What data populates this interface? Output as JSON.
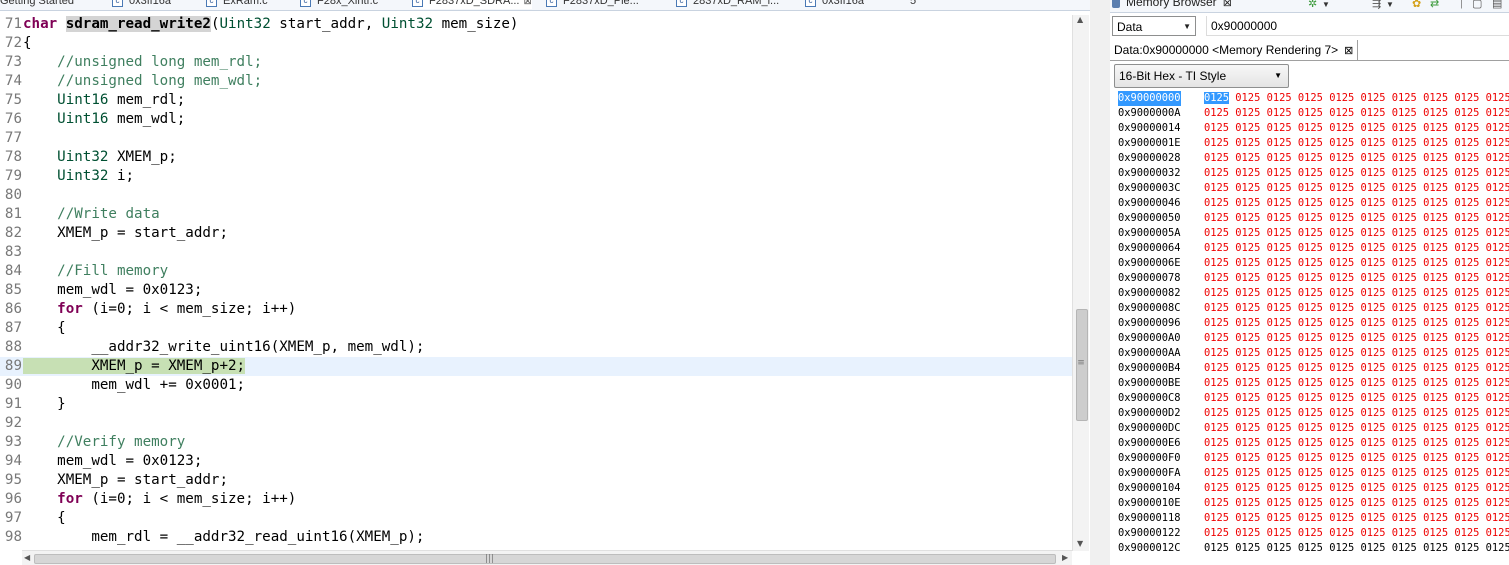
{
  "editor": {
    "tabs": [
      {
        "label": "Getting Started",
        "icon": "none",
        "close": false
      },
      {
        "label": "0x3ff16a",
        "icon": "c-file-icon",
        "close": false
      },
      {
        "label": "ExRam.c",
        "icon": "c-file-icon",
        "close": false
      },
      {
        "label": "F28x_Xintf.c",
        "icon": "c-file-icon",
        "close": false
      },
      {
        "label": "F2837xD_SDRA...",
        "icon": "c-file-icon",
        "close": true,
        "close_label": "⊠"
      },
      {
        "label": "F2837xD_Pie...",
        "icon": "c-file-icon",
        "close": false
      },
      {
        "label": "2837xD_RAM_l...",
        "icon": "linker-file-icon",
        "close": false
      },
      {
        "label": "0x3ff16a",
        "icon": "c-file-icon",
        "close": false
      },
      {
        "label": "5",
        "icon": "none",
        "close": false
      }
    ],
    "code_lines": [
      {
        "num": "71",
        "segments": [
          {
            "t": "kw",
            "s": "char"
          },
          {
            "t": "p",
            "s": " "
          },
          {
            "t": "fnd",
            "s": "sdram_read_write2"
          },
          {
            "t": "p",
            "s": "("
          },
          {
            "t": "ty",
            "s": "Uint32"
          },
          {
            "t": "p",
            "s": " start_addr, "
          },
          {
            "t": "ty",
            "s": "Uint32"
          },
          {
            "t": "p",
            "s": " mem_size)"
          }
        ]
      },
      {
        "num": "72",
        "segments": [
          {
            "t": "p",
            "s": "{"
          }
        ]
      },
      {
        "num": "73",
        "segments": [
          {
            "t": "cm",
            "s": "    //unsigned long mem_rdl;"
          }
        ]
      },
      {
        "num": "74",
        "segments": [
          {
            "t": "cm",
            "s": "    //unsigned long mem_wdl;"
          }
        ]
      },
      {
        "num": "75",
        "segments": [
          {
            "t": "ty",
            "s": "    Uint16"
          },
          {
            "t": "p",
            "s": " mem_rdl;"
          }
        ]
      },
      {
        "num": "76",
        "segments": [
          {
            "t": "ty",
            "s": "    Uint16"
          },
          {
            "t": "p",
            "s": " mem_wdl;"
          }
        ]
      },
      {
        "num": "77",
        "segments": []
      },
      {
        "num": "78",
        "segments": [
          {
            "t": "ty",
            "s": "    Uint32"
          },
          {
            "t": "p",
            "s": " XMEM_p;"
          }
        ]
      },
      {
        "num": "79",
        "segments": [
          {
            "t": "ty",
            "s": "    Uint32"
          },
          {
            "t": "p",
            "s": " i;"
          }
        ]
      },
      {
        "num": "80",
        "segments": []
      },
      {
        "num": "81",
        "segments": [
          {
            "t": "cm",
            "s": "    //Write data"
          }
        ]
      },
      {
        "num": "82",
        "segments": [
          {
            "t": "p",
            "s": "    XMEM_p = start_addr;"
          }
        ]
      },
      {
        "num": "83",
        "segments": []
      },
      {
        "num": "84",
        "segments": [
          {
            "t": "cm",
            "s": "    //Fill memory"
          }
        ]
      },
      {
        "num": "85",
        "segments": [
          {
            "t": "p",
            "s": "    mem_wdl = 0x0123;"
          }
        ]
      },
      {
        "num": "86",
        "segments": [
          {
            "t": "p",
            "s": "    "
          },
          {
            "t": "kw",
            "s": "for"
          },
          {
            "t": "p",
            "s": " (i=0; i < mem_size; i++)"
          }
        ]
      },
      {
        "num": "87",
        "segments": [
          {
            "t": "p",
            "s": "    {"
          }
        ]
      },
      {
        "num": "88",
        "segments": [
          {
            "t": "p",
            "s": "        __addr32_write_uint16(XMEM_p, mem_wdl);"
          }
        ]
      },
      {
        "num": "89",
        "current": true,
        "segments": [
          {
            "t": "hl",
            "s": "        XMEM_p = XMEM_p+2;"
          }
        ]
      },
      {
        "num": "90",
        "segments": [
          {
            "t": "p",
            "s": "        mem_wdl += 0x0001;"
          }
        ]
      },
      {
        "num": "91",
        "segments": [
          {
            "t": "p",
            "s": "    }"
          }
        ]
      },
      {
        "num": "92",
        "segments": []
      },
      {
        "num": "93",
        "segments": [
          {
            "t": "cm",
            "s": "    //Verify memory"
          }
        ]
      },
      {
        "num": "94",
        "segments": [
          {
            "t": "p",
            "s": "    mem_wdl = 0x0123;"
          }
        ]
      },
      {
        "num": "95",
        "segments": [
          {
            "t": "p",
            "s": "    XMEM_p = start_addr;"
          }
        ]
      },
      {
        "num": "96",
        "segments": [
          {
            "t": "p",
            "s": "    "
          },
          {
            "t": "kw",
            "s": "for"
          },
          {
            "t": "p",
            "s": " (i=0; i < mem_size; i++)"
          }
        ]
      },
      {
        "num": "97",
        "segments": [
          {
            "t": "p",
            "s": "    {"
          }
        ]
      },
      {
        "num": "98",
        "segments": [
          {
            "t": "p",
            "s": "        mem_rdl = __addr32_read_uint16(XMEM_p);"
          }
        ]
      }
    ],
    "vscroll_grip": "≡",
    "hscroll_grip": "|||"
  },
  "memory": {
    "view_title": "Memory Browser",
    "view_close": "⊠",
    "space_value": "Data",
    "address_value": "0x90000000",
    "rendering_tab": "Data:0x90000000 <Memory Rendering 7>",
    "rendering_close": "⊠",
    "format_value": "16-Bit Hex - TI Style",
    "cell_value": "0125",
    "cells_per_row": 10,
    "rows": [
      {
        "addr": "0x90000000",
        "changed": true,
        "selected": true
      },
      {
        "addr": "0x9000000A",
        "changed": true
      },
      {
        "addr": "0x90000014",
        "changed": true
      },
      {
        "addr": "0x9000001E",
        "changed": true
      },
      {
        "addr": "0x90000028",
        "changed": true
      },
      {
        "addr": "0x90000032",
        "changed": true
      },
      {
        "addr": "0x9000003C",
        "changed": true
      },
      {
        "addr": "0x90000046",
        "changed": true
      },
      {
        "addr": "0x90000050",
        "changed": true
      },
      {
        "addr": "0x9000005A",
        "changed": true
      },
      {
        "addr": "0x90000064",
        "changed": true
      },
      {
        "addr": "0x9000006E",
        "changed": true
      },
      {
        "addr": "0x90000078",
        "changed": true
      },
      {
        "addr": "0x90000082",
        "changed": true
      },
      {
        "addr": "0x9000008C",
        "changed": true
      },
      {
        "addr": "0x90000096",
        "changed": true
      },
      {
        "addr": "0x900000A0",
        "changed": true
      },
      {
        "addr": "0x900000AA",
        "changed": true
      },
      {
        "addr": "0x900000B4",
        "changed": true
      },
      {
        "addr": "0x900000BE",
        "changed": true
      },
      {
        "addr": "0x900000C8",
        "changed": true
      },
      {
        "addr": "0x900000D2",
        "changed": true
      },
      {
        "addr": "0x900000DC",
        "changed": true
      },
      {
        "addr": "0x900000E6",
        "changed": true
      },
      {
        "addr": "0x900000F0",
        "changed": true
      },
      {
        "addr": "0x900000FA",
        "changed": true
      },
      {
        "addr": "0x90000104",
        "changed": true
      },
      {
        "addr": "0x9000010E",
        "changed": true
      },
      {
        "addr": "0x90000118",
        "changed": true
      },
      {
        "addr": "0x90000122",
        "changed": true
      },
      {
        "addr": "0x9000012C",
        "changed": false
      }
    ]
  },
  "colors": {
    "changed_value": "#ee0000",
    "selection": "#3399ff",
    "current_line": "#e8f2fe",
    "keyword": "#7f0055",
    "comment": "#3f7f5f",
    "type": "#005032"
  }
}
